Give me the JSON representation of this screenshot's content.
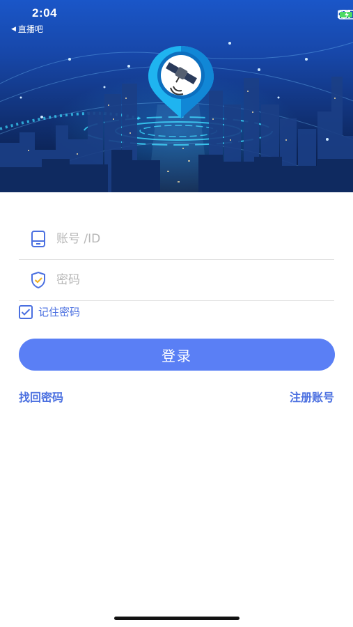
{
  "status_bar": {
    "time": "2:04",
    "back_app_label": "直播吧",
    "back_icon": "back-triangle-icon",
    "icons": [
      "cellular-signal-icon",
      "wifi-icon",
      "battery-charging-icon"
    ]
  },
  "banner": {
    "logo_icon": "location-pin-satellite-icon"
  },
  "form": {
    "account_placeholder": "账号 /ID",
    "account_icon": "phone-icon",
    "password_placeholder": "密码",
    "password_icon": "shield-check-icon",
    "remember_label": "记住密码",
    "remember_checked": true
  },
  "actions": {
    "login_label": "登录",
    "forgot_password_label": "找回密码",
    "register_label": "注册账号"
  },
  "colors": {
    "accent": "#4a6fe0",
    "button": "#5a7ff5",
    "banner_top": "#1a56c8",
    "banner_bottom": "#0a1c44"
  }
}
